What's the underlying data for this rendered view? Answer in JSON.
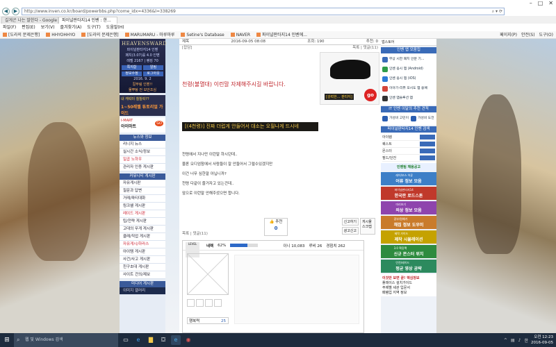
{
  "browser": {
    "url": "http://www.inven.co.kr/board/powerbbs.php?come_idx=4336&l=338269",
    "tabs": [
      "길게곤 나는 말한다 - Google",
      "파이널판타지14 인벤 : 한..."
    ],
    "menu": [
      "파일(F)",
      "편집(E)",
      "보기(V)",
      "즐겨찾기(A)",
      "도구(T)",
      "도움말(H)"
    ],
    "favorites": [
      "[도라의 문제은행]",
      "HHYOHHYO",
      "[도라의 문제은행]",
      "MARUMARU - 마루마루",
      "Setine's Database",
      "NAVER",
      "파이널판타지14 인벤에..."
    ],
    "tools": [
      "페이지(P)",
      "안전(S)",
      "도구(O)"
    ]
  },
  "sidebar": {
    "logo": "HEAVENSWARD",
    "login_lines": [
      "파이널판타지14 인벤",
      "패치(3.07)를 4.0 인벤",
      "레벨 2167 | 랭킹 70"
    ],
    "login_buttons": [
      "쪽지함",
      "알림",
      "정보수정",
      "로그아웃"
    ],
    "notice_lines": [
      "2016. 9. 2",
      "칼부림 인벤!!",
      "물뿌탕 전 보안조심"
    ],
    "promo": [
      "내 캐릭터 칠칠락??",
      "1~50레벨 튜토리얼 가이드"
    ],
    "imart": [
      "I-MART",
      "아이마트",
      "GO"
    ],
    "sections": [
      {
        "title": "뉴스와 정보",
        "items": [
          "리니지 뉴스",
          "실시간 소식/정보",
          "일곱 노하우",
          "관리자 인증 게시판"
        ]
      },
      {
        "title": "커뮤니티 게시판",
        "items": [
          "자유게시판",
          "질문과 답변",
          "거래/파티대화",
          "링크쉘 게시판",
          "레이드 게시판",
          "팁/전략 게시판",
          "고대의 무게 게시판",
          "클래/직업 게시판",
          "자유게시/하라스",
          "아이템 게시판",
          "사건/사고 게시판",
          "친구초대 게시판",
          "사이트 건의/제보"
        ]
      },
      {
        "title": "미디어 게시판",
        "items": [
          "이미지 갤러리"
        ]
      }
    ]
  },
  "article": {
    "meta_left": "제목",
    "date": "2016-09-05 08:08",
    "views_label": "조회: 190",
    "recommend_label": "추천: 0",
    "category": "[잡담]",
    "top_links": "목록 | 댓글(11)",
    "red_line": "천령(불멸대) 이런말 자제해주시길 바랍니다.",
    "ad_label": "[강력한... 판타지]",
    "ad_go": "go",
    "highlight": "[(4천령)] 진짜 더럽게 안들어서 대소는 오필나게 드시네",
    "paragraphs": [
      "천령에서 지나만 이런말 하시던데..",
      "물론 오디엄참에서 사람들이 잘 안들어서 그럴수있겠지만",
      "이건 너무 심한말 아닙니까?",
      "천령 다같이 즐거자고 있는건데..",
      "앞으로 이런말 안해주셨으면 합니다."
    ],
    "vote_label": "추천",
    "vote_count": "0",
    "side_buttons": [
      "신고하기",
      "광고신고",
      "게시물 스크랩"
    ],
    "bottom_links": "목록 | 댓글(11)",
    "profile": {
      "level_label": "LEVEL",
      "name": "네렉",
      "exp_percent": 62,
      "exp_text": "62%",
      "inven_points": "이니 10,083",
      "ruby": "루비 26",
      "exp_value": "경험치 262",
      "score_label": "행복력",
      "score_value": "25"
    }
  },
  "right": {
    "top_apps": "앱스토어",
    "app_section": "인벤 앱 모음집",
    "apps": [
      "무상 시한 패치 안분 기...",
      "인벤 응시 앱 (Android)",
      "인벤 응시 앱 (iOS)",
      "이야기-리뷰 오시도 앱 용예",
      "인벤 앱솔루션 앱"
    ],
    "it_section": "IT 인벤 이달의 추천 견적",
    "it_items": [
      "가성비 고민이",
      "가성비 도전"
    ],
    "search_title": "파이널판타지14 인벤 검색",
    "search_rows": [
      "아이템",
      "퀘스트",
      "몬스터",
      "필드/던전"
    ],
    "recruit": "인벤팀 채용공고",
    "banners": [
      {
        "title": "어류 정보 모음",
        "sub": "레어/보스 어류",
        "color": "#3d7fc7"
      },
      {
        "title": "한국판 로드스톤",
        "sub": "파이널판타지14",
        "color": "#c0392b"
      },
      {
        "title": "의상 정보 모음",
        "sub": "미리보기",
        "color": "#8e44ad"
      },
      {
        "title": "채집 정보 도우미",
        "sub": "광부/원예가",
        "color": "#c97b2b"
      },
      {
        "title": "제작 시뮬레이션",
        "sub": "제작 가이드",
        "color": "#c5a200"
      },
      {
        "title": "신규 몬스터 위치",
        "sub": "3.0 확장팩",
        "color": "#2e8b3f"
      },
      {
        "title": "펑균 영상 공략",
        "sub": "던전/레이드",
        "color": "#2c8a5e"
      }
    ],
    "more_title": "이것만 보면 끝! 핵심정보",
    "more_items": [
      "플레이스 설치가이드",
      "주제별 세관 입문서",
      "패템업 지역 정보"
    ]
  },
  "taskbar": {
    "search_placeholder": "웹 및 Windows 검색",
    "time": "오전 12:23",
    "date": "2016-09-05"
  }
}
